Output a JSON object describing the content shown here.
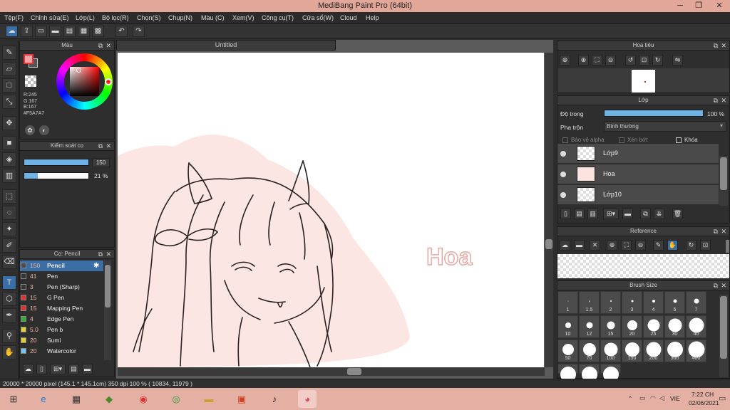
{
  "window": {
    "title": "MediBang Paint Pro (64bit)"
  },
  "menu": [
    "Tệp(F)",
    "Chỉnh sửa(E)",
    "Lớp(L)",
    "Bộ lọc(R)",
    "Chọn(S)",
    "Chụp(N)",
    "Màu (C)",
    "Xem(V)",
    "Công cụ(T)",
    "Cửa sổ(W)",
    "Cloud",
    "Help"
  ],
  "color_panel": {
    "title": "Màu",
    "r": "R:245",
    "g": "G:167",
    "b": "B:167",
    "hex": "#F5A7A7",
    "primary_color": "#f5a7a7"
  },
  "size_panel": {
    "title": "Kiểm soát cọ",
    "size_value": "150",
    "opacity_value": "21 %",
    "opacity_fraction": 0.21,
    "size_fraction": 1.0
  },
  "brush_panel": {
    "title": "Cọ: Pencil",
    "items": [
      {
        "size": "150",
        "name": "Pencil",
        "color": "#4a4a4a"
      },
      {
        "size": "41",
        "name": "Pen",
        "color": "#333333"
      },
      {
        "size": "3",
        "name": "Pen (Sharp)",
        "color": "#333333"
      },
      {
        "size": "15",
        "name": "G Pen",
        "color": "#e03030"
      },
      {
        "size": "15",
        "name": "Mapping Pen",
        "color": "#e03030"
      },
      {
        "size": "4",
        "name": "Edge Pen",
        "color": "#30b030"
      },
      {
        "size": "5.0",
        "name": "Pen b",
        "color": "#e0d030"
      },
      {
        "size": "20",
        "name": "Sumi",
        "color": "#e0d030"
      },
      {
        "size": "20",
        "name": "Watercolor",
        "color": "#6fc8f0"
      }
    ]
  },
  "canvas": {
    "tab": "Untitled",
    "text_on_canvas": "Hoa"
  },
  "navigator": {
    "title": "Hoa tiêu"
  },
  "layer_panel": {
    "title": "Lớp",
    "opacity_label": "Độ trong",
    "opacity_value": "100 %",
    "opacity_fraction": 1.0,
    "blend_label": "Pha trộn",
    "blend_value": "Bình thường",
    "alpha_label": "Bảo vệ alpha",
    "clip_label": "Xén bớt",
    "lock_label": "Khóa",
    "layers": [
      "Lớp9",
      "Hoa",
      "Lớp10"
    ]
  },
  "reference_panel": {
    "title": "Reference"
  },
  "brush_size_panel": {
    "title": "Brush Size",
    "sizes": [
      "1",
      "1.5",
      "2",
      "3",
      "4",
      "5",
      "7",
      "10",
      "12",
      "15",
      "20",
      "25",
      "30",
      "40",
      "50",
      "70",
      "100",
      "150",
      "200",
      "300",
      "400"
    ]
  },
  "status": {
    "text": "20000 * 20000 pixel   (145.1 * 145.1cm)   350 dpi   100 %   ( 10834, 11979 )"
  },
  "taskbar": {
    "lang": "VIE",
    "time": "7:22 CH",
    "date": "02/06/2021"
  }
}
